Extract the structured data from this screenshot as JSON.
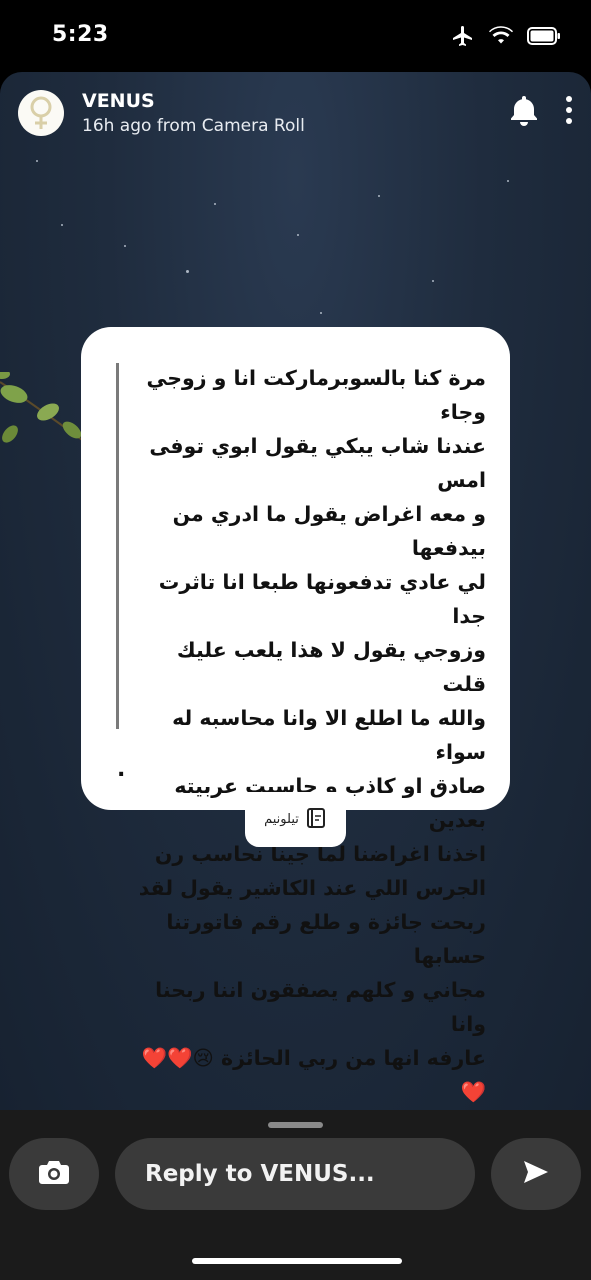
{
  "status_bar": {
    "time": "5:23"
  },
  "story": {
    "poster_name": "VENUS",
    "poster_subtitle": "16h ago from Camera Roll",
    "quote_lines": [
      "مرة كنا بالسوبرماركت انا و زوجي وجاء",
      "عندنا شاب يبكي يقول ابوي توفى امس",
      "و معه اغراض يقول ما ادري من بيدفعها",
      "لي عادي تدفعونها طبعا انا تاثرت جدا",
      "وزوجي يقول لا هذا يلعب عليك قلت",
      "والله ما اطلع الا وانا محاسبه له سواء",
      "صادق او كاذب و حاسبت عربيته بعدين",
      "اخذنا اغراضنا لما جينا نحاسب رن",
      "الجرس اللي عند الكاشير يقول لقد",
      "ربحت جائزة و طلع رقم فاتورتنا حسابها",
      "مجاني و كلهم يصفقون اننا ربحنا وانا",
      "عارفه انها من ربي الحائزة 😢❤️❤️",
      "❤️"
    ],
    "quote_trailing": ".",
    "source_label": "تيلونيم"
  },
  "reply": {
    "placeholder": "Reply to VENUS..."
  },
  "colors": {
    "background": "#1f2c3e",
    "card": "#ffffff",
    "bar": "#1b1b1b"
  },
  "icons": [
    "airplane-icon",
    "wifi-icon",
    "battery-icon",
    "venus-avatar-icon",
    "bell-icon",
    "more-vertical-icon",
    "book-icon",
    "camera-icon",
    "send-icon"
  ]
}
